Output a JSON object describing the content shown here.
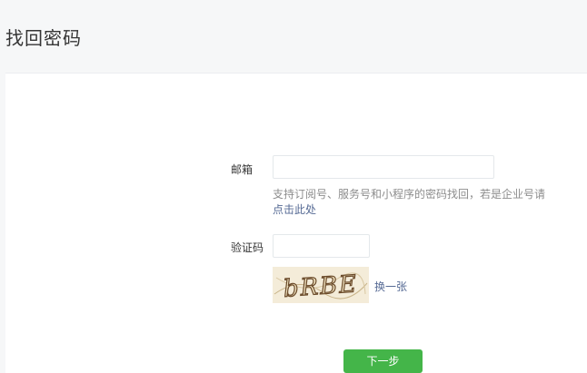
{
  "page": {
    "title": "找回密码"
  },
  "form": {
    "email_label": "邮箱",
    "email_value": "",
    "tip_text": "支持订阅号、服务号和小程序的密码找回，若是企业号请",
    "tip_link": "点击此处",
    "captcha_label": "验证码",
    "captcha_value": "",
    "captcha_text": "bRBE",
    "refresh_link": "换一张",
    "next_button": "下一步"
  },
  "colors": {
    "primary_green": "#44b549",
    "link_blue": "#576b95"
  }
}
